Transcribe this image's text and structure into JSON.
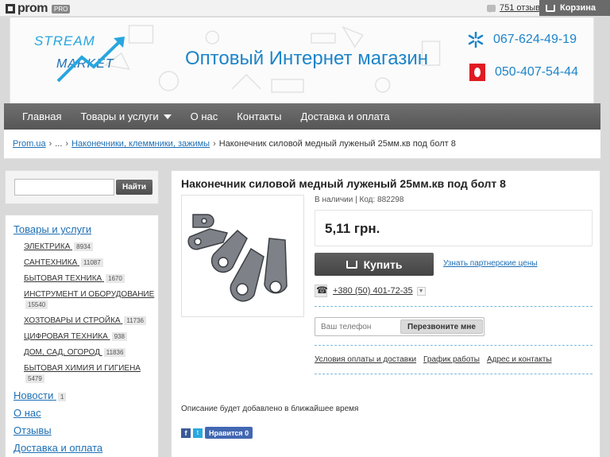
{
  "topbar": {
    "brand": "prom",
    "badge": "PRO",
    "reviews": "751 отзыв",
    "cart": "Корзина"
  },
  "header": {
    "logo_line1": "STREAM",
    "logo_line2": "MARKET",
    "title": "Оптовый Интернет магазин",
    "phone_kyivstar": "067-624-49-19",
    "phone_vodafone": "050-407-54-44"
  },
  "nav": {
    "items": [
      "Главная",
      "Товары и услуги",
      "О нас",
      "Контакты",
      "Доставка и оплата"
    ]
  },
  "breadcrumb": {
    "root": "Prom.ua",
    "ellipsis": "...",
    "category": "Наконечники, клеммники, зажимы",
    "current": "Наконечник силовой медный луженый 25мм.кв под болт 8",
    "sep": "›"
  },
  "search": {
    "placeholder": "",
    "button": "Найти"
  },
  "catalog": {
    "heading": "Товары и услуги",
    "items": [
      {
        "label": "Электрика",
        "count": "8934"
      },
      {
        "label": "Сантехника",
        "count": "11087"
      },
      {
        "label": "Бытовая техника",
        "count": "1670"
      },
      {
        "label": "Инструмент и оборудование",
        "count": "15540"
      },
      {
        "label": "Хозтовары и стройка",
        "count": "11736"
      },
      {
        "label": "Цифровая техника",
        "count": "938"
      },
      {
        "label": "Дом, сад, огород",
        "count": "11836"
      },
      {
        "label": "Бытовая химия и гигиена",
        "count": "5479"
      }
    ],
    "news": "Новости",
    "news_count": "1",
    "about": "О нас",
    "reviews": "Отзывы",
    "delivery": "Доставка и оплата"
  },
  "product": {
    "title": "Наконечник силовой медный луженый 25мм.кв под болт 8",
    "stock": "В наличии | Код: 882298",
    "price": "5,11 грн.",
    "buy": "Купить",
    "partner": "Узнать партнерские цены",
    "phone": "+380 (50) 401-72-35",
    "callback_placeholder": "Ваш телефон",
    "callback_button": "Перезвоните мне",
    "links": [
      "Условия оплаты и доставки",
      "График работы",
      "Адрес и контакты"
    ],
    "description": "Описание будет добавлено в ближайшее время",
    "like": "Нравится 0"
  },
  "colors": {
    "accent": "#1d84c9",
    "nav": "#5e5e5e",
    "link": "#1d6fb5"
  }
}
